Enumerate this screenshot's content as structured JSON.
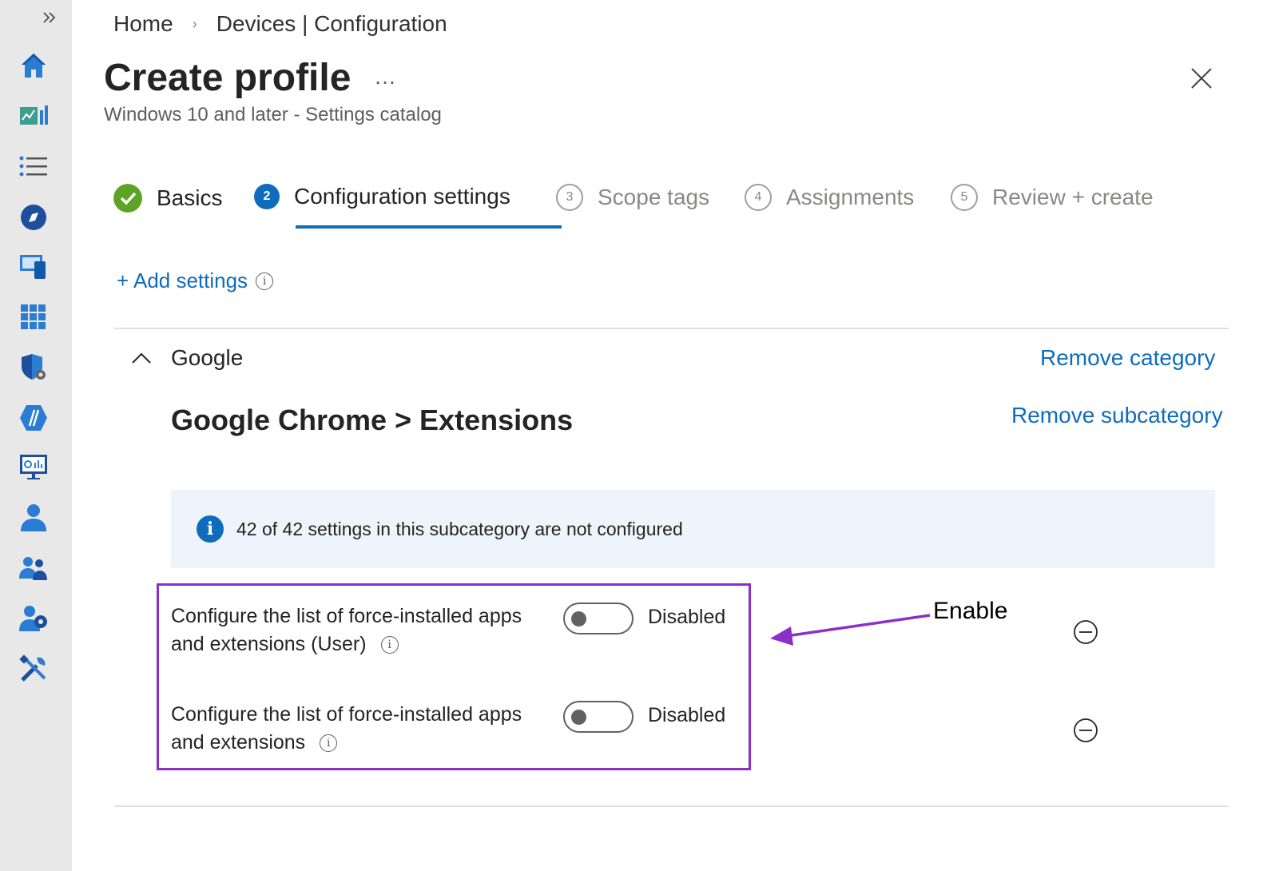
{
  "breadcrumb": {
    "home": "Home",
    "section": "Devices | Configuration"
  },
  "header": {
    "title": "Create profile",
    "more": "…",
    "subtitle": "Windows 10 and later - Settings catalog"
  },
  "steps": [
    {
      "label": "Basics",
      "number": "",
      "state": "done"
    },
    {
      "label": "Configuration settings",
      "number": "2",
      "state": "current"
    },
    {
      "label": "Scope tags",
      "number": "3",
      "state": "inactive"
    },
    {
      "label": "Assignments",
      "number": "4",
      "state": "inactive"
    },
    {
      "label": "Review + create",
      "number": "5",
      "state": "inactive"
    }
  ],
  "add_settings": {
    "label": "+ Add settings",
    "info": "i"
  },
  "category": {
    "name": "Google",
    "remove_label": "Remove category",
    "subcategory": "Google Chrome > Extensions",
    "remove_subcategory_label": "Remove subcategory",
    "info_text": "42 of 42 settings in this subcategory are not configured",
    "info_icon": "i"
  },
  "settings": [
    {
      "line1": "Configure the list of force-installed apps",
      "line2": "and extensions (User)",
      "state": "Disabled",
      "info": "i"
    },
    {
      "line1": "Configure the list of force-installed apps",
      "line2": "and extensions",
      "state": "Disabled",
      "info": "i"
    }
  ],
  "annotation": {
    "text": "Enable",
    "color": "#8b2fc9"
  },
  "colors": {
    "accent": "#0f6cbd",
    "success": "#5ea226",
    "sidebar_bg": "#e8e8e8"
  },
  "sidebar_icons": [
    "home-icon",
    "dashboard-icon",
    "all-services-icon",
    "devices-icon",
    "apps-icon",
    "endpoint-security-icon",
    "reports-icon",
    "users-icon",
    "groups-icon",
    "tenant-admin-icon",
    "troubleshooting-icon"
  ]
}
